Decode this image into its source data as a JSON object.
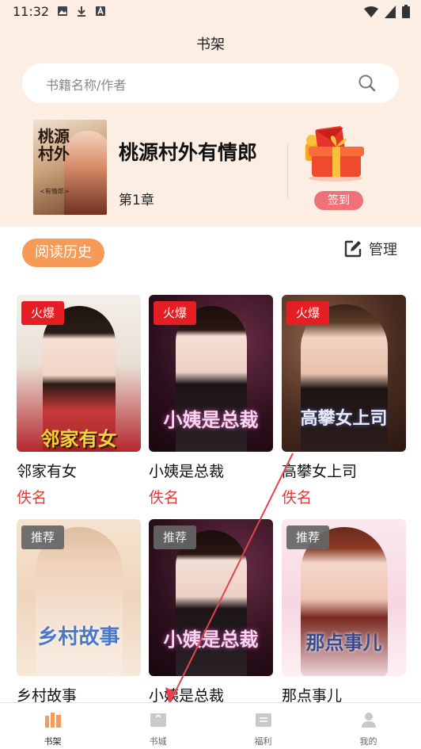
{
  "status": {
    "time": "11:32"
  },
  "header": {
    "title": "书架"
  },
  "search": {
    "placeholder": "书籍名称/作者"
  },
  "current": {
    "cover_text": "桃源村外",
    "cover_sub": "<有情郎>",
    "title": "桃源村外有情郎",
    "chapter": "第1章",
    "signin_label": "签到"
  },
  "actions": {
    "history_label": "阅读历史",
    "manage_label": "管理"
  },
  "books": [
    {
      "title": "邻家有女",
      "author": "佚名",
      "badge": "火爆",
      "cover_text": "邻家有女"
    },
    {
      "title": "小姨是总裁",
      "author": "佚名",
      "badge": "火爆",
      "cover_text": "小姨是总裁"
    },
    {
      "title": "高攀女上司",
      "author": "佚名",
      "badge": "火爆",
      "cover_text": "高攀女上司"
    },
    {
      "title": "乡村故事",
      "author": "",
      "badge": "推荐",
      "cover_text": "乡村故事"
    },
    {
      "title": "小姨是总裁",
      "author": "",
      "badge": "推荐",
      "cover_text": "小姨是总裁"
    },
    {
      "title": "那点事儿",
      "author": "",
      "badge": "推荐",
      "cover_text": "那点事儿"
    }
  ],
  "tabs": [
    {
      "label": "书架",
      "icon": "bookshelf-icon"
    },
    {
      "label": "书城",
      "icon": "bookstore-icon"
    },
    {
      "label": "福利",
      "icon": "welfare-icon"
    },
    {
      "label": "我的",
      "icon": "profile-icon"
    }
  ],
  "colors": {
    "accent": "#f79a55",
    "badge_hot": "#e51e23",
    "author_red": "#e23a3a",
    "signin": "#f07279",
    "top_bg": "#fdeee4",
    "arrow": "#e5434c"
  }
}
